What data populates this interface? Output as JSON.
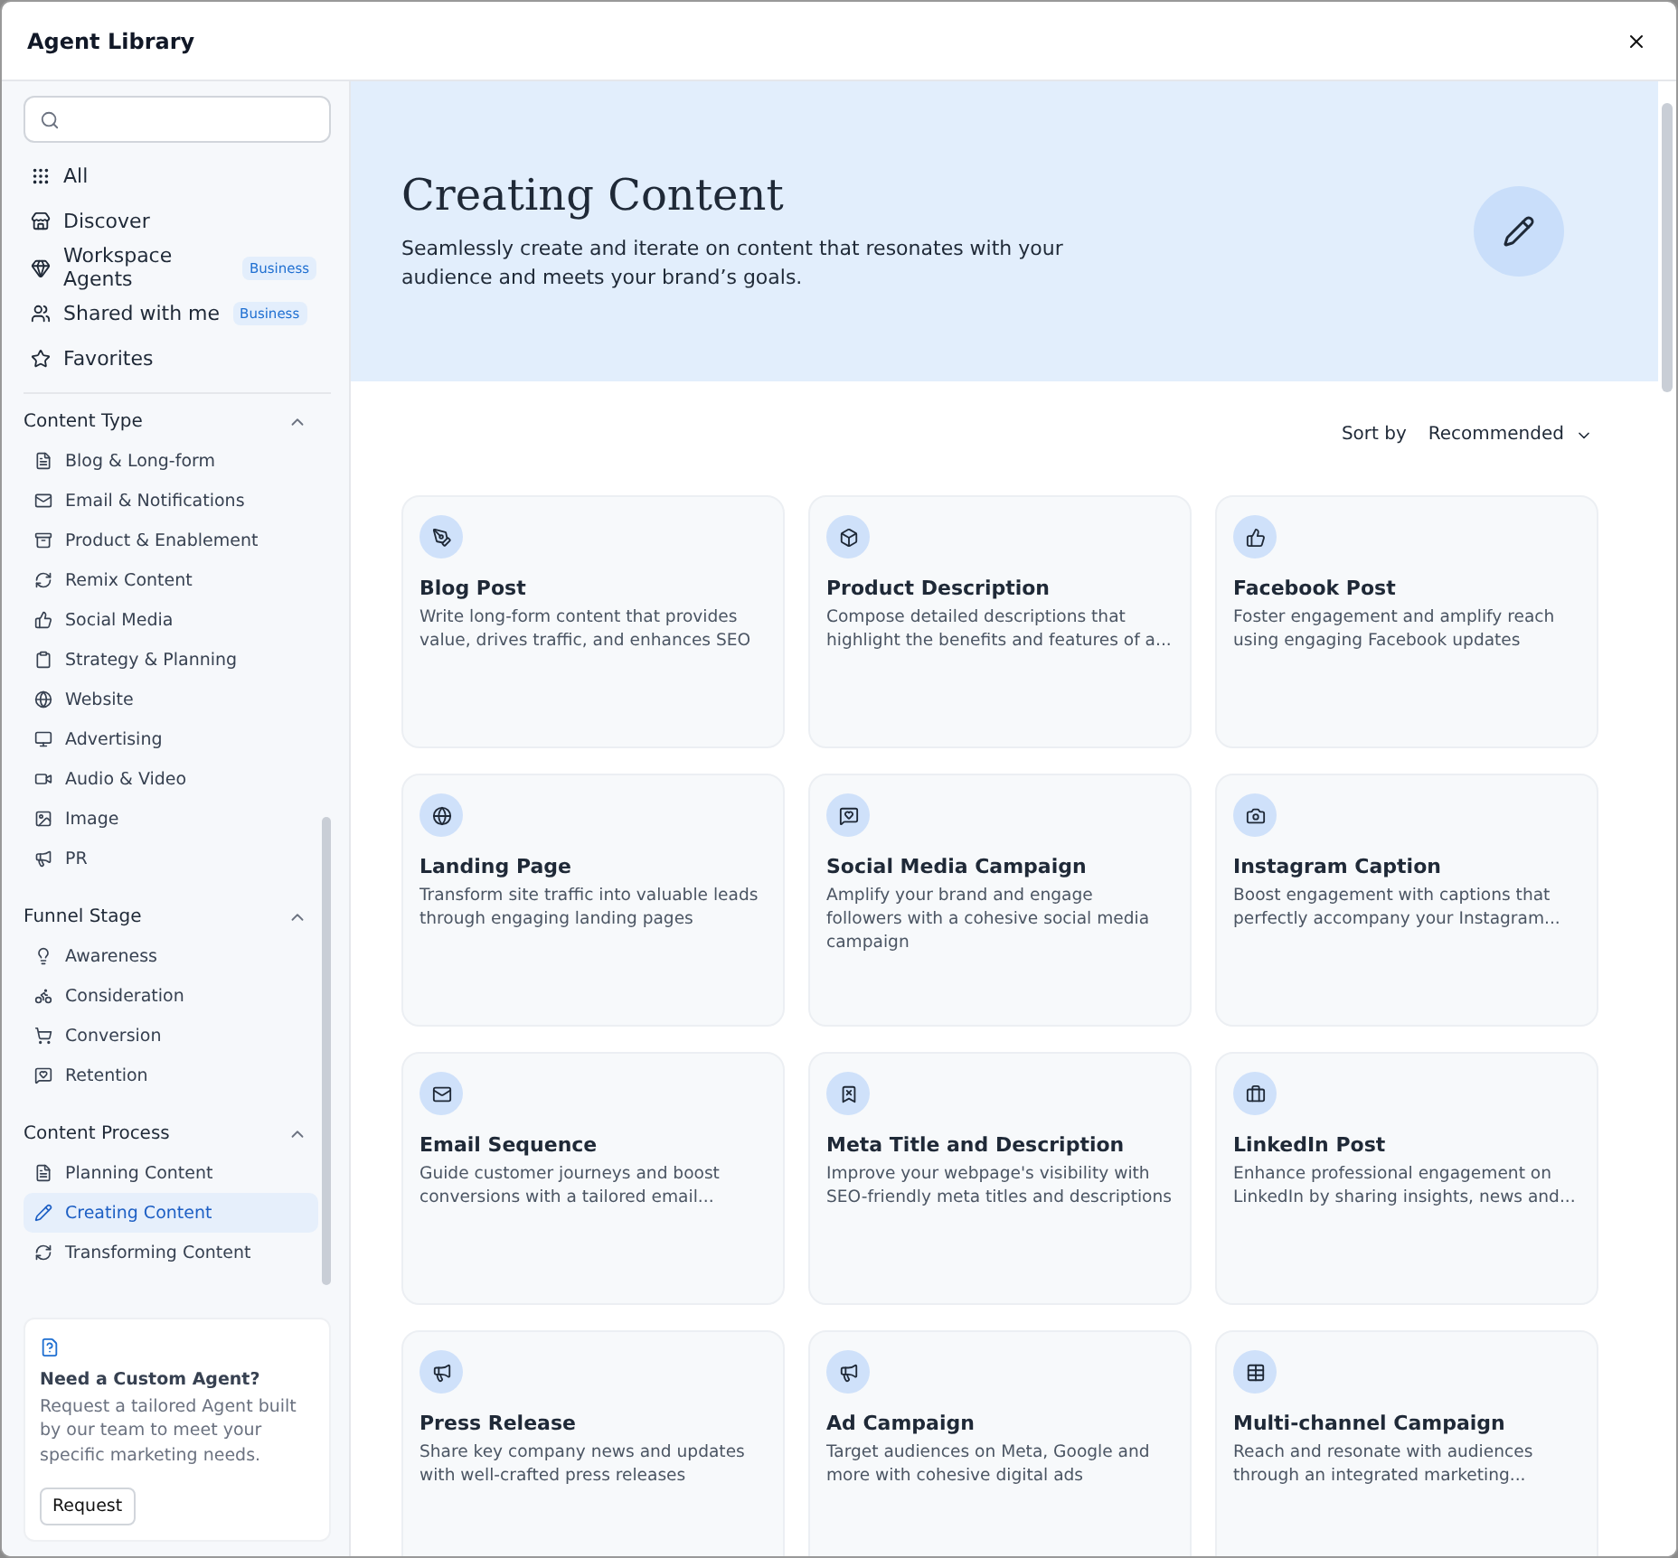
{
  "window": {
    "title": "Agent Library"
  },
  "sidebar": {
    "nav": [
      {
        "label": "All",
        "selected": false
      },
      {
        "label": "Discover",
        "selected": false
      },
      {
        "label": "Workspace Agents",
        "badge": "Business",
        "selected": false
      },
      {
        "label": "Shared with me",
        "badge": "Business",
        "selected": false
      },
      {
        "label": "Favorites",
        "selected": false
      }
    ],
    "sections": [
      {
        "title": "Content Type",
        "expanded": true,
        "items": [
          {
            "label": "Blog & Long-form",
            "selected": false
          },
          {
            "label": "Email & Notifications",
            "selected": false
          },
          {
            "label": "Product & Enablement",
            "selected": false
          },
          {
            "label": "Remix Content",
            "selected": false
          },
          {
            "label": "Social Media",
            "selected": false
          },
          {
            "label": "Strategy & Planning",
            "selected": false
          },
          {
            "label": "Website",
            "selected": false
          },
          {
            "label": "Advertising",
            "selected": false
          },
          {
            "label": "Audio & Video",
            "selected": false
          },
          {
            "label": "Image",
            "selected": false
          },
          {
            "label": "PR",
            "selected": false
          }
        ]
      },
      {
        "title": "Funnel Stage",
        "expanded": true,
        "items": [
          {
            "label": "Awareness",
            "selected": false
          },
          {
            "label": "Consideration",
            "selected": false
          },
          {
            "label": "Conversion",
            "selected": false
          },
          {
            "label": "Retention",
            "selected": false
          }
        ]
      },
      {
        "title": "Content Process",
        "expanded": true,
        "items": [
          {
            "label": "Planning Content",
            "selected": false
          },
          {
            "label": "Creating Content",
            "selected": true
          },
          {
            "label": "Transforming Content",
            "selected": false
          }
        ]
      }
    ],
    "promo": {
      "title": "Need a Custom Agent?",
      "text": "Request a tailored Agent built by our team to meet your specific marketing needs.",
      "button": "Request"
    }
  },
  "hero": {
    "title": "Creating Content",
    "subtitle": "Seamlessly create and iterate on content that resonates with your audience and meets your brand’s goals."
  },
  "sort": {
    "label": "Sort by",
    "value": "Recommended"
  },
  "cards": [
    {
      "title": "Blog Post",
      "description": "Write long-form content that provides value, drives traffic, and enhances SEO"
    },
    {
      "title": "Product Description",
      "description": "Compose detailed descriptions that highlight the benefits and features of a..."
    },
    {
      "title": "Facebook Post",
      "description": "Foster engagement and amplify reach using engaging Facebook updates"
    },
    {
      "title": "Landing Page",
      "description": "Transform site traffic into valuable leads through engaging landing pages"
    },
    {
      "title": "Social Media Campaign",
      "description": "Amplify your brand and engage followers with a cohesive social media campaign"
    },
    {
      "title": "Instagram Caption",
      "description": "Boost engagement with captions that perfectly accompany your Instagram..."
    },
    {
      "title": "Email Sequence",
      "description": "Guide customer journeys and boost conversions with a tailored email..."
    },
    {
      "title": "Meta Title and Description",
      "description": "Improve your webpage's visibility with SEO-friendly meta titles and descriptions"
    },
    {
      "title": "LinkedIn Post",
      "description": "Enhance professional engagement on LinkedIn by sharing insights, news and..."
    },
    {
      "title": "Press Release",
      "description": "Share key company news and updates with well-crafted press releases"
    },
    {
      "title": "Ad Campaign",
      "description": "Target audiences on Meta, Google and more with cohesive digital ads"
    },
    {
      "title": "Multi-channel Campaign",
      "description": "Reach and resonate with audiences through an integrated marketing..."
    }
  ]
}
